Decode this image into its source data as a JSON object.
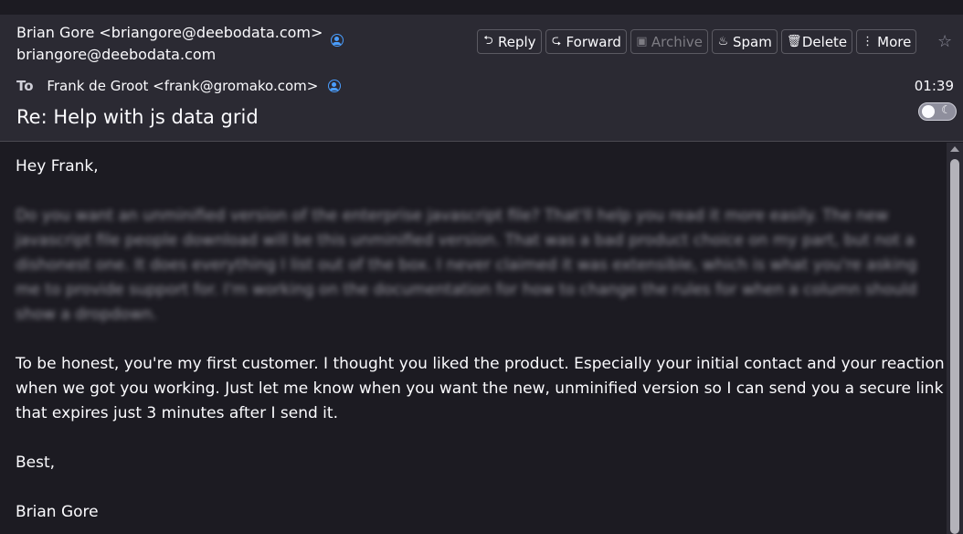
{
  "message": {
    "from": "Brian Gore <briangore@deebodata.com>",
    "from_address": "briangore@deebodata.com",
    "to_label": "To",
    "to": "Frank de Groot <frank@gromako.com>",
    "time": "01:39",
    "subject": "Re: Help with js data grid"
  },
  "toolbar": {
    "reply": "Reply",
    "forward": "Forward",
    "archive": "Archive",
    "spam": "Spam",
    "delete": "Delete",
    "more": "More"
  },
  "body": {
    "greeting": "Hey Frank,",
    "blurred_paragraph": "Do you want an unminified version of the enterprise javascript file? That'll help you read it more easily. The new javascript file people download will be this unminified version. That was a bad product choice on my part, but not a dishonest one. It does everything I list out of the box. I never claimed it was extensible, which is what you're asking me to provide support for. I'm working on the documentation for how to change the rules for when a column should show a dropdown.",
    "paragraph2": "To be honest, you're my first customer. I thought you liked the product. Especially your initial contact and your reaction when we got you working. Just let me know when you want the new, unminified version so I can send you a secure link that expires just 3 minutes after I send it.",
    "closing": "Best,",
    "signature": "Brian Gore"
  },
  "icons": {
    "reply": "reply-icon",
    "forward": "forward-icon",
    "archive": "archive-icon",
    "spam": "spam-icon",
    "delete": "trash-icon",
    "more": "more-icon",
    "star": "star-icon",
    "contact": "contact-icon"
  },
  "colors": {
    "accent": "#4a9eff",
    "header_bg": "#2b2a33",
    "body_bg": "#1c1b22"
  }
}
